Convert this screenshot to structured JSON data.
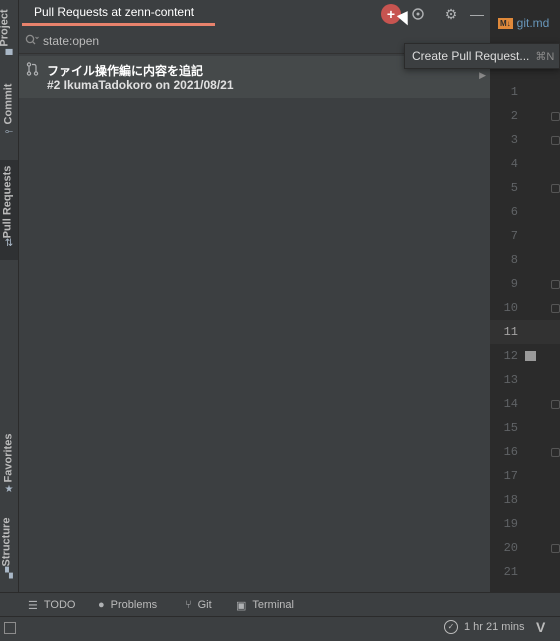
{
  "left_strip": {
    "project": "Project",
    "commit": "Commit",
    "pull_requests": "Pull Requests",
    "favorites": "Favorites",
    "structure": "Structure"
  },
  "toolwindow": {
    "tab_label": "Pull Requests at zenn-content",
    "add_icon": "plus-icon",
    "target_icon": "crosshair-icon",
    "settings_icon": "gear-icon",
    "minimize_icon": "minus-icon"
  },
  "filter": {
    "value": "state:open"
  },
  "pull_requests": [
    {
      "title": "ファイル操作編に内容を追記",
      "meta": "#2 IkumaTadokoro on 2021/08/21"
    }
  ],
  "popup": {
    "label": "Create Pull Request...",
    "shortcut": "⌘N"
  },
  "editor": {
    "file_badge": "M↓",
    "file_name": "git.md",
    "current_line": "11",
    "lines": [
      "1",
      "2",
      "3",
      "4",
      "5",
      "6",
      "7",
      "8",
      "9",
      "10",
      "11",
      "12",
      "13",
      "14",
      "15",
      "16",
      "17",
      "18",
      "19",
      "20",
      "21"
    ]
  },
  "bottom_tools": {
    "todo": "TODO",
    "problems": "Problems",
    "git": "Git",
    "terminal": "Terminal"
  },
  "status": {
    "time": "1 hr 21 mins"
  }
}
